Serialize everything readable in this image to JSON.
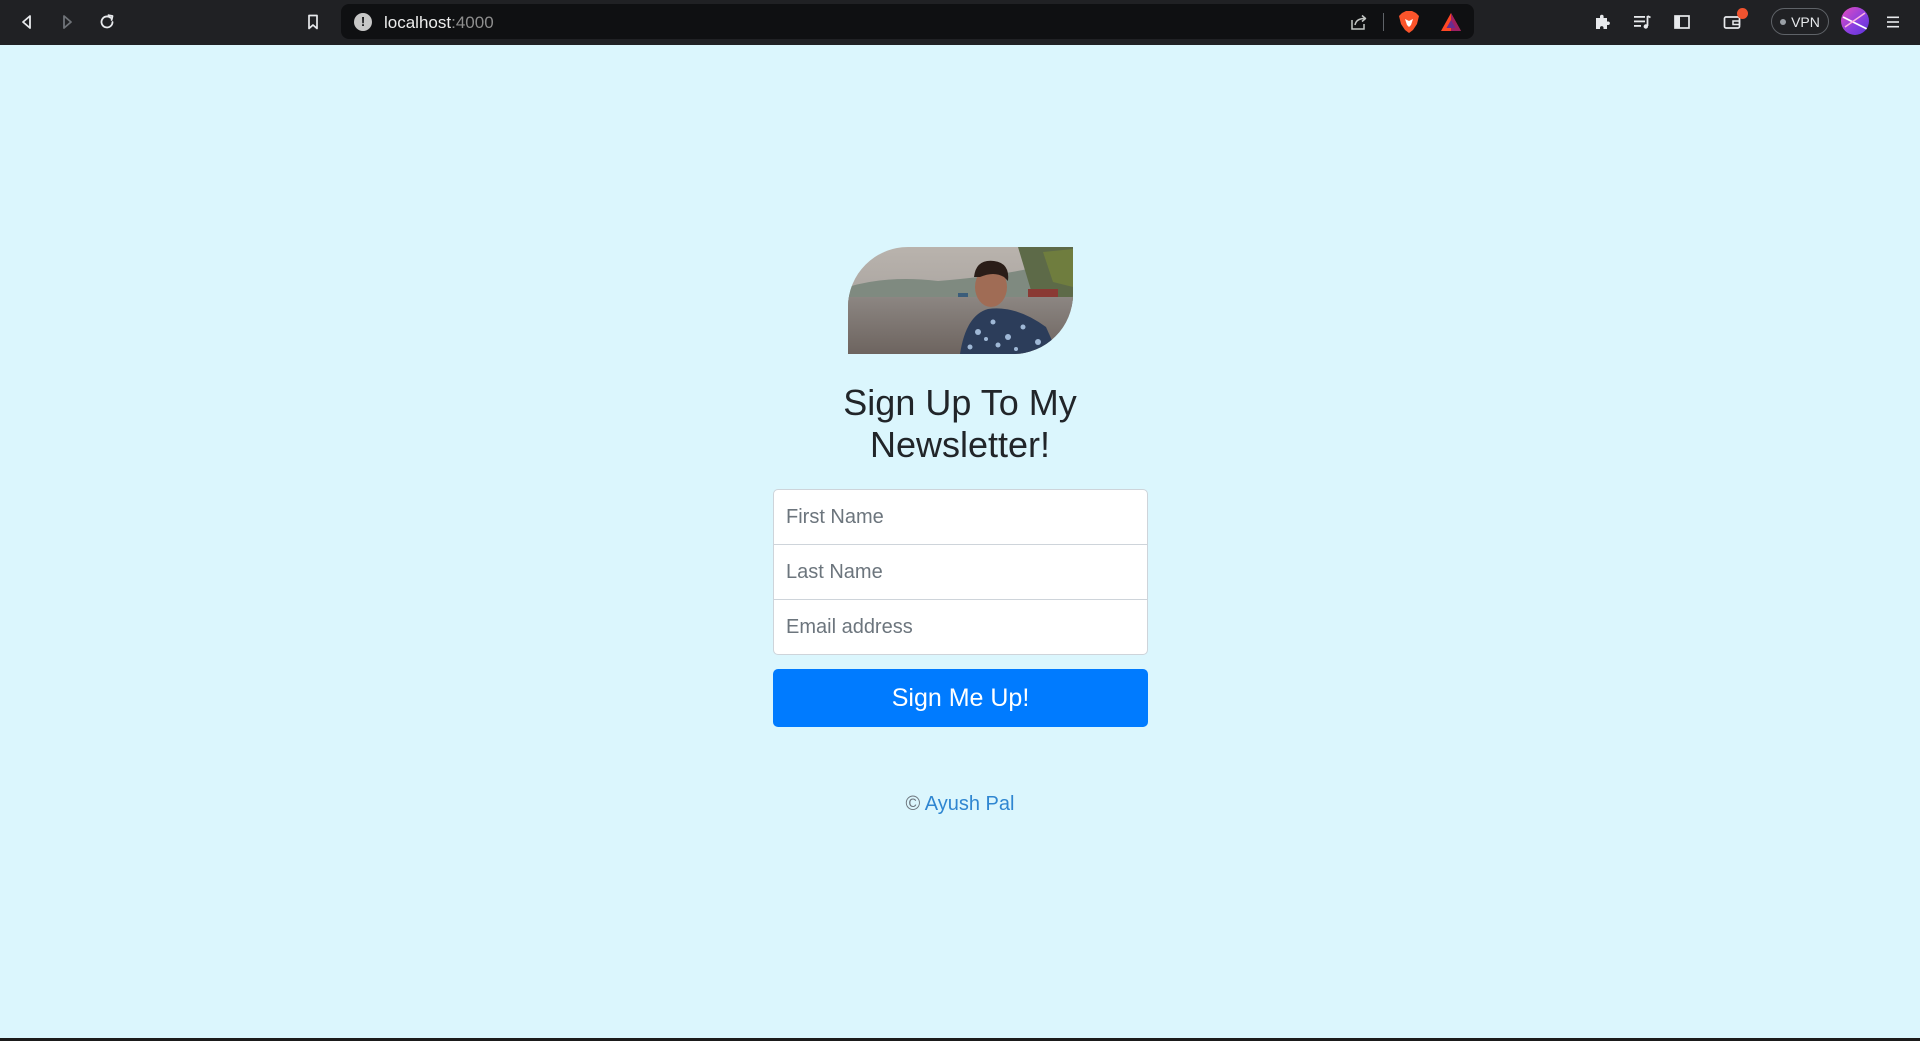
{
  "browser": {
    "url_host": "localhost",
    "url_port": ":4000",
    "vpn_label": "VPN",
    "icons": {
      "back": "back-icon",
      "forward": "forward-icon",
      "reload": "reload-icon",
      "bookmark": "bookmark-icon",
      "site_info": "info-icon",
      "share": "share-icon",
      "brave_shields": "brave-lion-icon",
      "brave_rewards": "rewards-triangle-icon",
      "extensions": "puzzle-icon",
      "playlist": "playlist-icon",
      "sidebar": "sidebar-icon",
      "wallet": "wallet-icon",
      "menu": "menu-icon"
    }
  },
  "page": {
    "headline": "Sign Up To My Newsletter!",
    "fields": {
      "first_name_placeholder": "First Name",
      "last_name_placeholder": "Last Name",
      "email_placeholder": "Email address"
    },
    "submit_label": "Sign Me Up!",
    "footer_copyright": "©",
    "footer_author": "Ayush Pal"
  },
  "colors": {
    "background": "#dbf6fd",
    "primary_button": "#007bff",
    "link": "#2f86d1"
  }
}
